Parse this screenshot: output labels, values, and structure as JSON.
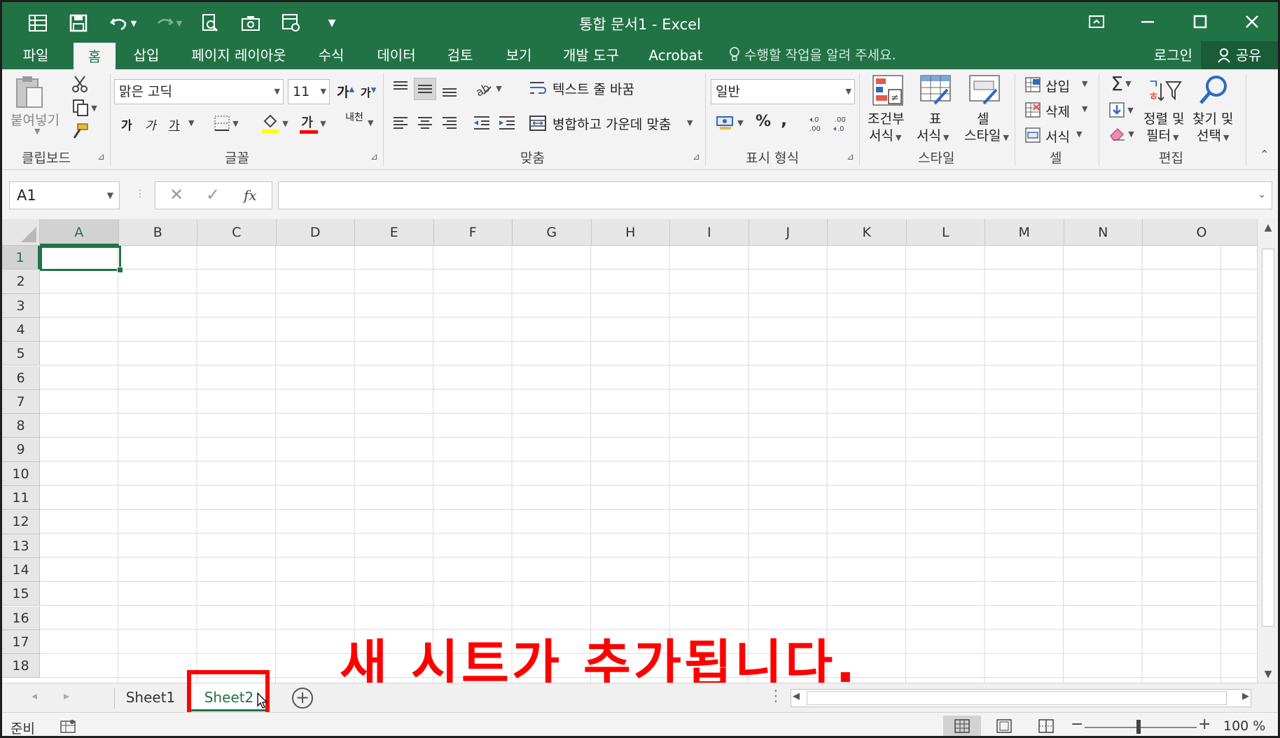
{
  "window": {
    "title": "통합 문서1 - Excel"
  },
  "quick_access": [
    {
      "icon": "form-icon",
      "glyph": "▤"
    },
    {
      "icon": "save-icon",
      "glyph": "💾"
    },
    {
      "icon": "undo-icon",
      "glyph": "↶▾"
    },
    {
      "icon": "redo-icon",
      "glyph": "↷▾"
    },
    {
      "icon": "print-preview-icon",
      "glyph": "🔍"
    },
    {
      "icon": "camera-icon",
      "glyph": "⌸"
    },
    {
      "icon": "format-icon",
      "glyph": "⚙"
    },
    {
      "icon": "customize-qat-icon",
      "glyph": "▾"
    }
  ],
  "tabs": {
    "file": "파일",
    "home": "홈",
    "insert": "삽입",
    "page_layout": "페이지 레이아웃",
    "formulas": "수식",
    "data": "데이터",
    "review": "검토",
    "view": "보기",
    "developer": "개발 도구",
    "acrobat": "Acrobat",
    "tell_me": "수행할 작업을 알려 주세요.",
    "login": "로그인",
    "share": "공유"
  },
  "ribbon": {
    "clipboard": {
      "label": "클립보드",
      "paste": "붙여넣기"
    },
    "font": {
      "label": "글꼴",
      "font_name": "맑은 고딕",
      "font_size": "11",
      "grow": "가",
      "shrink": "가",
      "bold": "가",
      "italic": "가",
      "underline": "가",
      "font_color": "가",
      "phonetic": "내천"
    },
    "alignment": {
      "label": "맞춤",
      "wrap_text": "텍스트 줄 바꿈",
      "merge_center": "병합하고 가운데 맞춤"
    },
    "number": {
      "label": "표시 형식",
      "format": "일반",
      "percent": "%",
      "comma": ","
    },
    "styles": {
      "label": "스타일",
      "conditional_1": "조건부",
      "conditional_2": "서식",
      "table_1": "표",
      "table_2": "서식",
      "cell_1": "셀",
      "cell_2": "스타일"
    },
    "cells": {
      "label": "셀",
      "insert": "삽입",
      "delete": "삭제",
      "format": "서식"
    },
    "editing": {
      "label": "편집",
      "sort_1": "정렬 및",
      "sort_2": "필터",
      "find_1": "찾기 및",
      "find_2": "선택"
    }
  },
  "formula_bar": {
    "name_box": "A1",
    "fx": "fx",
    "value": ""
  },
  "columns": [
    "A",
    "B",
    "C",
    "D",
    "E",
    "F",
    "G",
    "H",
    "I",
    "J",
    "K",
    "L",
    "M",
    "N",
    "O"
  ],
  "rows": [
    "1",
    "2",
    "3",
    "4",
    "5",
    "6",
    "7",
    "8",
    "9",
    "10",
    "11",
    "12",
    "13",
    "14",
    "15",
    "16",
    "17",
    "18"
  ],
  "active_cell": "A1",
  "annotation": "새 시트가 추가됩니다.",
  "sheets": [
    "Sheet1",
    "Sheet2"
  ],
  "active_sheet": "Sheet2",
  "status": {
    "ready": "준비",
    "zoom": "100 %"
  },
  "colors": {
    "excel_green": "#217346",
    "annotation_red": "#ff0000"
  }
}
